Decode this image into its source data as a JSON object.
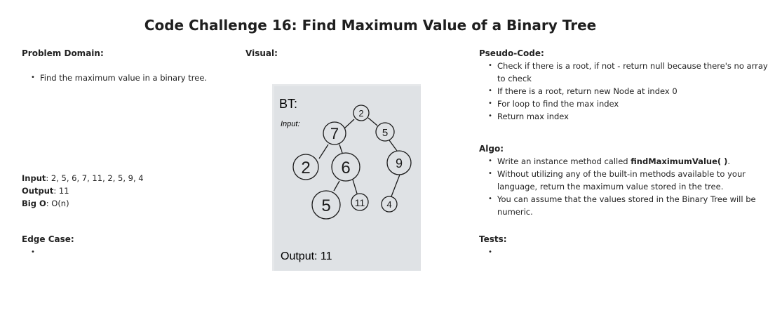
{
  "title": "Code Challenge 16: Find Maximum Value of a Binary Tree",
  "problem": {
    "heading": "Problem Domain:",
    "items": [
      "Find the maximum value in a binary tree."
    ]
  },
  "io": {
    "input_label": "Input",
    "input": ": 2, 5, 6, 7, 11, 2, 5, 9, 4",
    "output_label": "Output",
    "output": ": 11",
    "bigo_label": "Big O",
    "bigo": ": O(n)"
  },
  "edge": {
    "heading": "Edge Case:",
    "items": [
      ""
    ]
  },
  "visual": {
    "heading": "Visual:",
    "whiteboard": {
      "label_bt": "BT:",
      "label_input": "Input:",
      "label_output": "Output: 11",
      "nodes": [
        "2",
        "7",
        "5",
        "2",
        "6",
        "9",
        "5",
        "11",
        "4"
      ]
    }
  },
  "pseudo": {
    "heading": "Pseudo-Code:",
    "items": [
      "Check if there is a root, if not - return null because there's no array to check",
      "If there is a root, return new Node at index 0",
      "For loop to find the max index",
      "Return max index"
    ]
  },
  "algo": {
    "heading": "Algo:",
    "item1_pre": "Write an instance method called ",
    "item1_bold": "findMaximumValue( )",
    "item1_post": ".",
    "items": [
      "Without utilizing any of the built-in methods available to your language, return the maximum value stored in the tree.",
      "You can assume that the values stored in the Binary Tree will be numeric."
    ]
  },
  "tests": {
    "heading": "Tests:",
    "items": [
      ""
    ]
  }
}
